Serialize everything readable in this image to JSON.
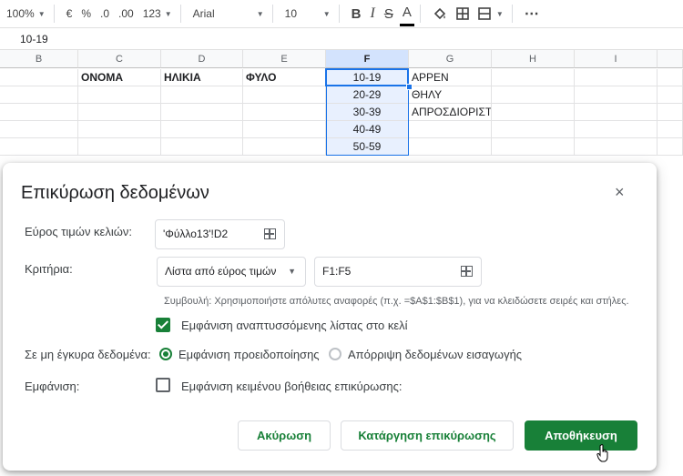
{
  "toolbar": {
    "zoom": "100%",
    "currency": "€",
    "percent": "%",
    "dec_less": ".0",
    "dec_more": ".00",
    "format_more": "123",
    "font": "Arial",
    "font_size": "10",
    "bold": "B",
    "italic": "I",
    "strike": "S",
    "text_color": "A",
    "more": "⋯"
  },
  "formula_bar": {
    "value": "10-19"
  },
  "columns": [
    "B",
    "C",
    "D",
    "E",
    "F",
    "G",
    "H",
    "I"
  ],
  "selected_column": "F",
  "headers": {
    "c": "ΟΝΟΜΑ",
    "d": "ΗΛΙΚΙΑ",
    "e": "ΦΥΛΟ"
  },
  "ages": [
    "10-19",
    "20-29",
    "30-39",
    "40-49",
    "50-59"
  ],
  "genders": [
    "ΑΡΡΕΝ",
    "ΘΗΛΥ",
    "ΑΠΡΟΣΔΙΟΡΙΣΤΟ"
  ],
  "dialog": {
    "title": "Επικύρωση δεδομένων",
    "close": "×",
    "range_label": "Εύρος τιμών κελιών:",
    "range_value": "'Φύλλο13'!D2",
    "criteria_label": "Κριτήρια:",
    "criteria_type": "Λίστα από εύρος τιμών",
    "criteria_range": "F1:F5",
    "hint": "Συμβουλή: Χρησιμοποιήστε απόλυτες αναφορές (π.χ. =$A$1:$B$1), για να κλειδώσετε σειρές και στήλες.",
    "show_dropdown_label": "Εμφάνιση αναπτυσσόμενης λίστας στο κελί",
    "invalid_label": "Σε μη έγκυρα δεδομένα:",
    "warn_label": "Εμφάνιση προειδοποίησης",
    "reject_label": "Απόρριψη δεδομένων εισαγωγής",
    "appearance_label": "Εμφάνιση:",
    "help_text_label": "Εμφάνιση κειμένου βοήθειας επικύρωσης:",
    "cancel": "Ακύρωση",
    "remove": "Κατάργηση επικύρωσης",
    "save": "Αποθήκευση"
  },
  "colors": {
    "accent": "#188038",
    "selection": "#1a73e8"
  }
}
